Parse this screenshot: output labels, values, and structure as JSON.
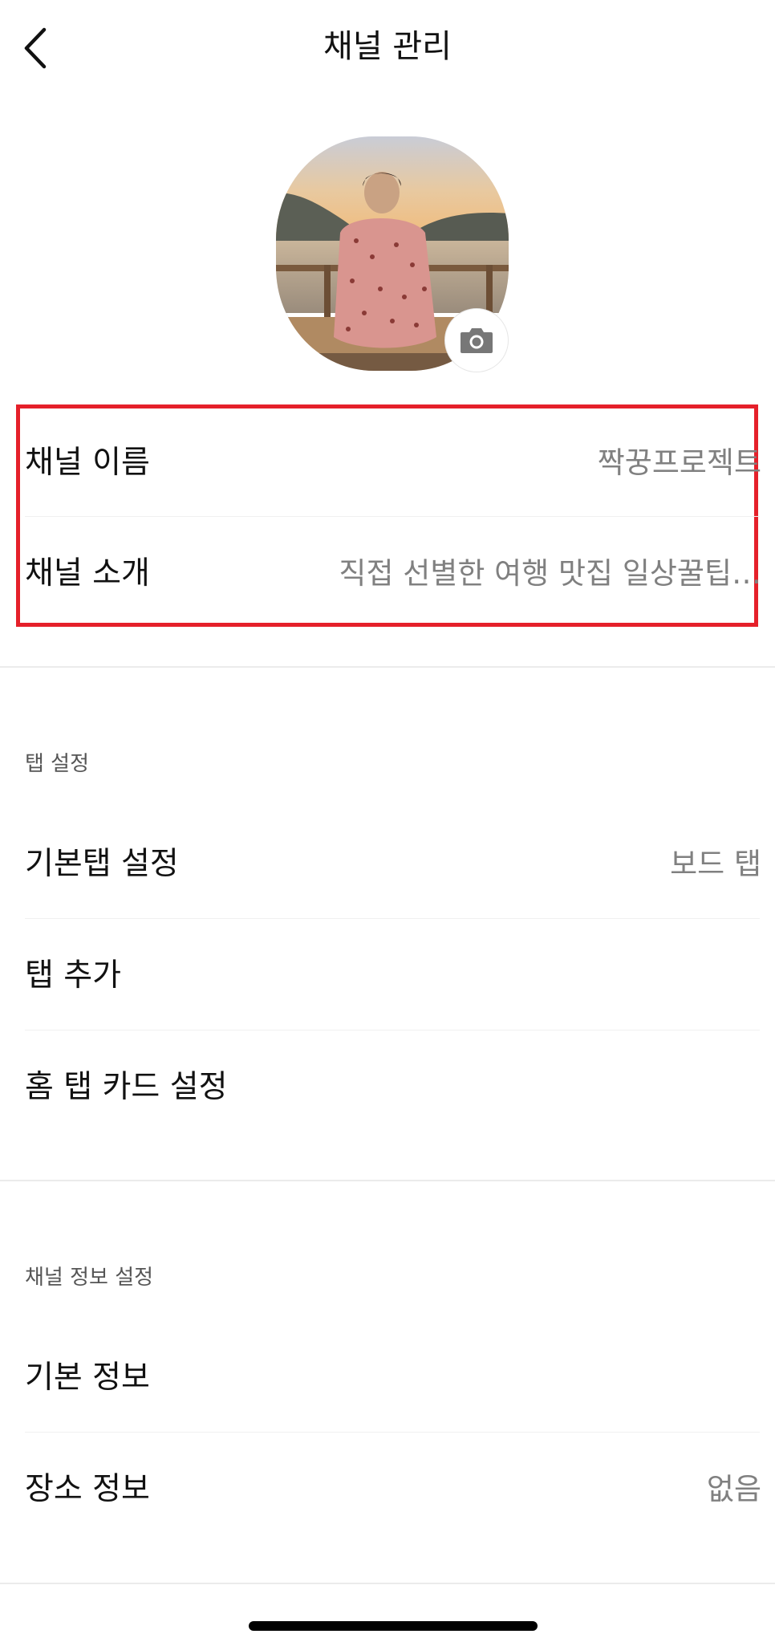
{
  "header": {
    "title": "채널 관리",
    "back_icon": "chevron-left-icon"
  },
  "profile": {
    "camera_icon": "camera-icon"
  },
  "channel_basic": [
    {
      "label": "채널 이름",
      "value": "짝꿍프로젝트"
    },
    {
      "label": "채널 소개",
      "value": "직접 선별한 여행 맛집 일상꿀팁…"
    }
  ],
  "tab_settings": {
    "section_title": "탭 설정",
    "items": [
      {
        "label": "기본탭 설정",
        "value": "보드 탭"
      },
      {
        "label": "탭 추가",
        "value": ""
      },
      {
        "label": "홈 탭 카드 설정",
        "value": ""
      }
    ]
  },
  "channel_info_settings": {
    "section_title": "채널 정보 설정",
    "items": [
      {
        "label": "기본 정보",
        "value": ""
      },
      {
        "label": "장소 정보",
        "value": "없음"
      }
    ]
  },
  "colors": {
    "highlight_border": "#e5202a",
    "value_text": "#808080",
    "divider": "#ebebeb"
  }
}
